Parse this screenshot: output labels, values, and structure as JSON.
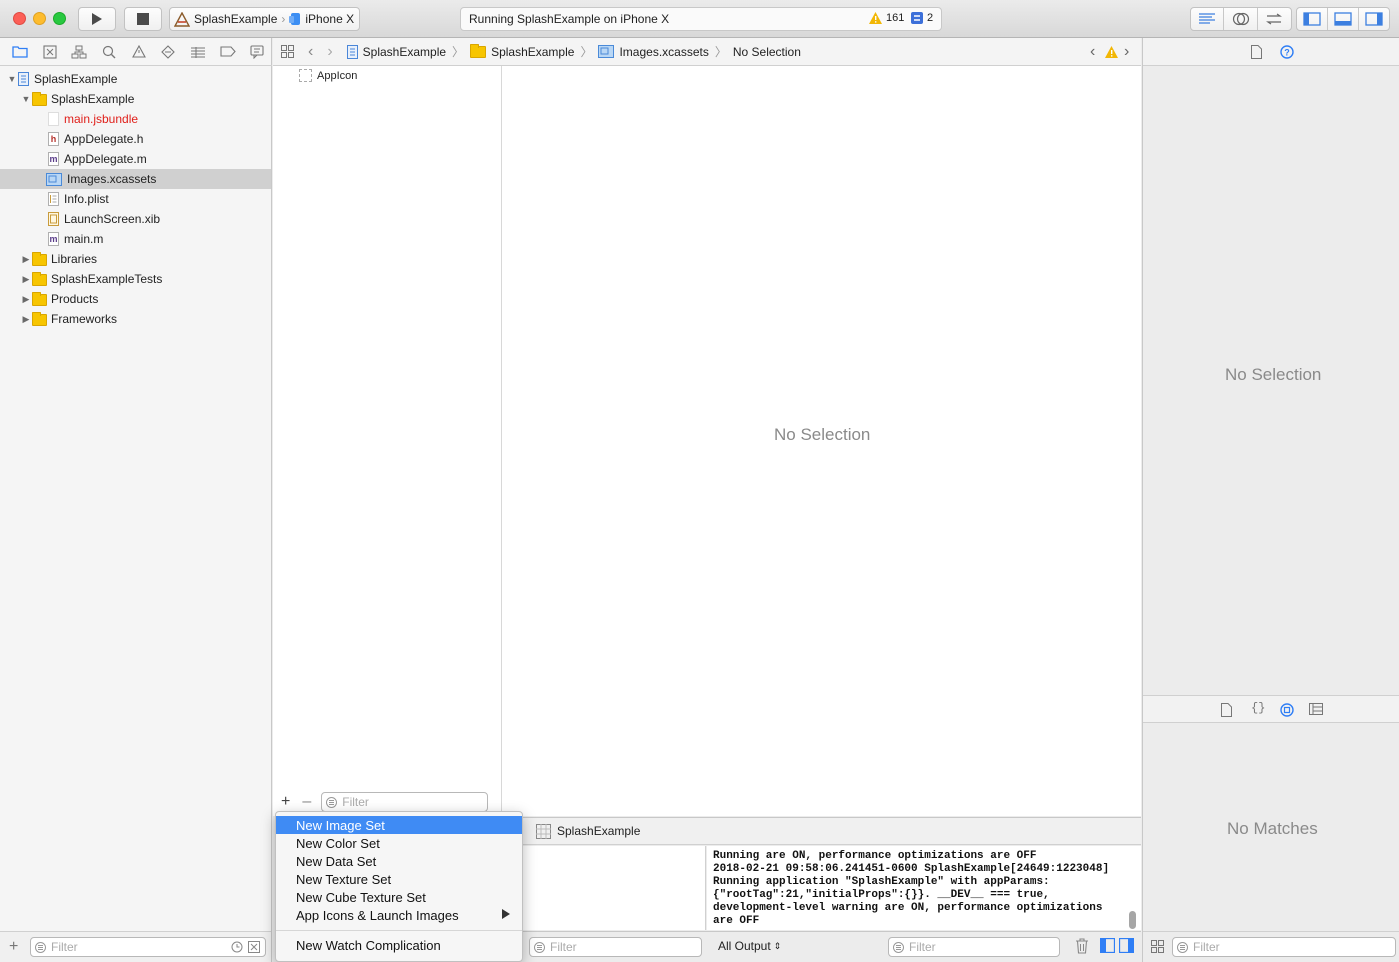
{
  "toolbar": {
    "scheme": {
      "project": "SplashExample",
      "device": "iPhone X"
    },
    "activity": {
      "status": "Running SplashExample on iPhone X",
      "warnings": "161",
      "issues": "2"
    }
  },
  "navigator": {
    "tree": [
      {
        "label": "SplashExample",
        "level": 0,
        "icon": "project-icon",
        "expanded": true
      },
      {
        "label": "SplashExample",
        "level": 1,
        "icon": "folder-icon",
        "expanded": true
      },
      {
        "label": "main.jsbundle",
        "level": 2,
        "icon": "file-icon",
        "missing": true
      },
      {
        "label": "AppDelegate.h",
        "level": 2,
        "icon": "header-file-icon"
      },
      {
        "label": "AppDelegate.m",
        "level": 2,
        "icon": "objc-file-icon"
      },
      {
        "label": "Images.xcassets",
        "level": 2,
        "icon": "asset-catalog-icon",
        "selected": true
      },
      {
        "label": "Info.plist",
        "level": 2,
        "icon": "plist-icon"
      },
      {
        "label": "LaunchScreen.xib",
        "level": 2,
        "icon": "xib-icon"
      },
      {
        "label": "main.m",
        "level": 2,
        "icon": "objc-file-icon"
      },
      {
        "label": "Libraries",
        "level": 1,
        "icon": "folder-icon",
        "expanded": false
      },
      {
        "label": "SplashExampleTests",
        "level": 1,
        "icon": "folder-icon",
        "expanded": false
      },
      {
        "label": "Products",
        "level": 1,
        "icon": "folder-icon",
        "expanded": false
      },
      {
        "label": "Frameworks",
        "level": 1,
        "icon": "folder-icon",
        "expanded": false
      }
    ],
    "filter_placeholder": "Filter"
  },
  "jumpbar": {
    "crumbs": [
      "SplashExample",
      "SplashExample",
      "Images.xcassets",
      "No Selection"
    ]
  },
  "assets": {
    "items": [
      "AppIcon"
    ],
    "filter_placeholder": "Filter",
    "detail_placeholder": "No Selection"
  },
  "debug": {
    "target": "SplashExample",
    "console_text": "Running are ON, performance optimizations are OFF\n2018-02-21 09:58:06.241451-0600 SplashExample[24649:1223048]\nRunning application \"SplashExample\" with appParams:\n{\"rootTag\":21,\"initialProps\":{}}. __DEV__ === true,\ndevelopment-level warning are ON, performance optimizations\nare OFF",
    "output_selector": "All Output",
    "vars_filter_placeholder": "Filter",
    "console_filter_placeholder": "Filter"
  },
  "inspector": {
    "top_placeholder": "No Selection",
    "bottom_placeholder": "No Matches",
    "filter_placeholder": "Filter"
  },
  "context_menu": {
    "items": [
      "New Image Set",
      "New Color Set",
      "New Data Set",
      "New Texture Set",
      "New Cube Texture Set",
      "App Icons & Launch Images"
    ],
    "extra_item": "New Watch Complication"
  },
  "colors": {
    "accent": "#3f8bf4",
    "missing_file": "#e0201b",
    "folder": "#f7c500"
  }
}
